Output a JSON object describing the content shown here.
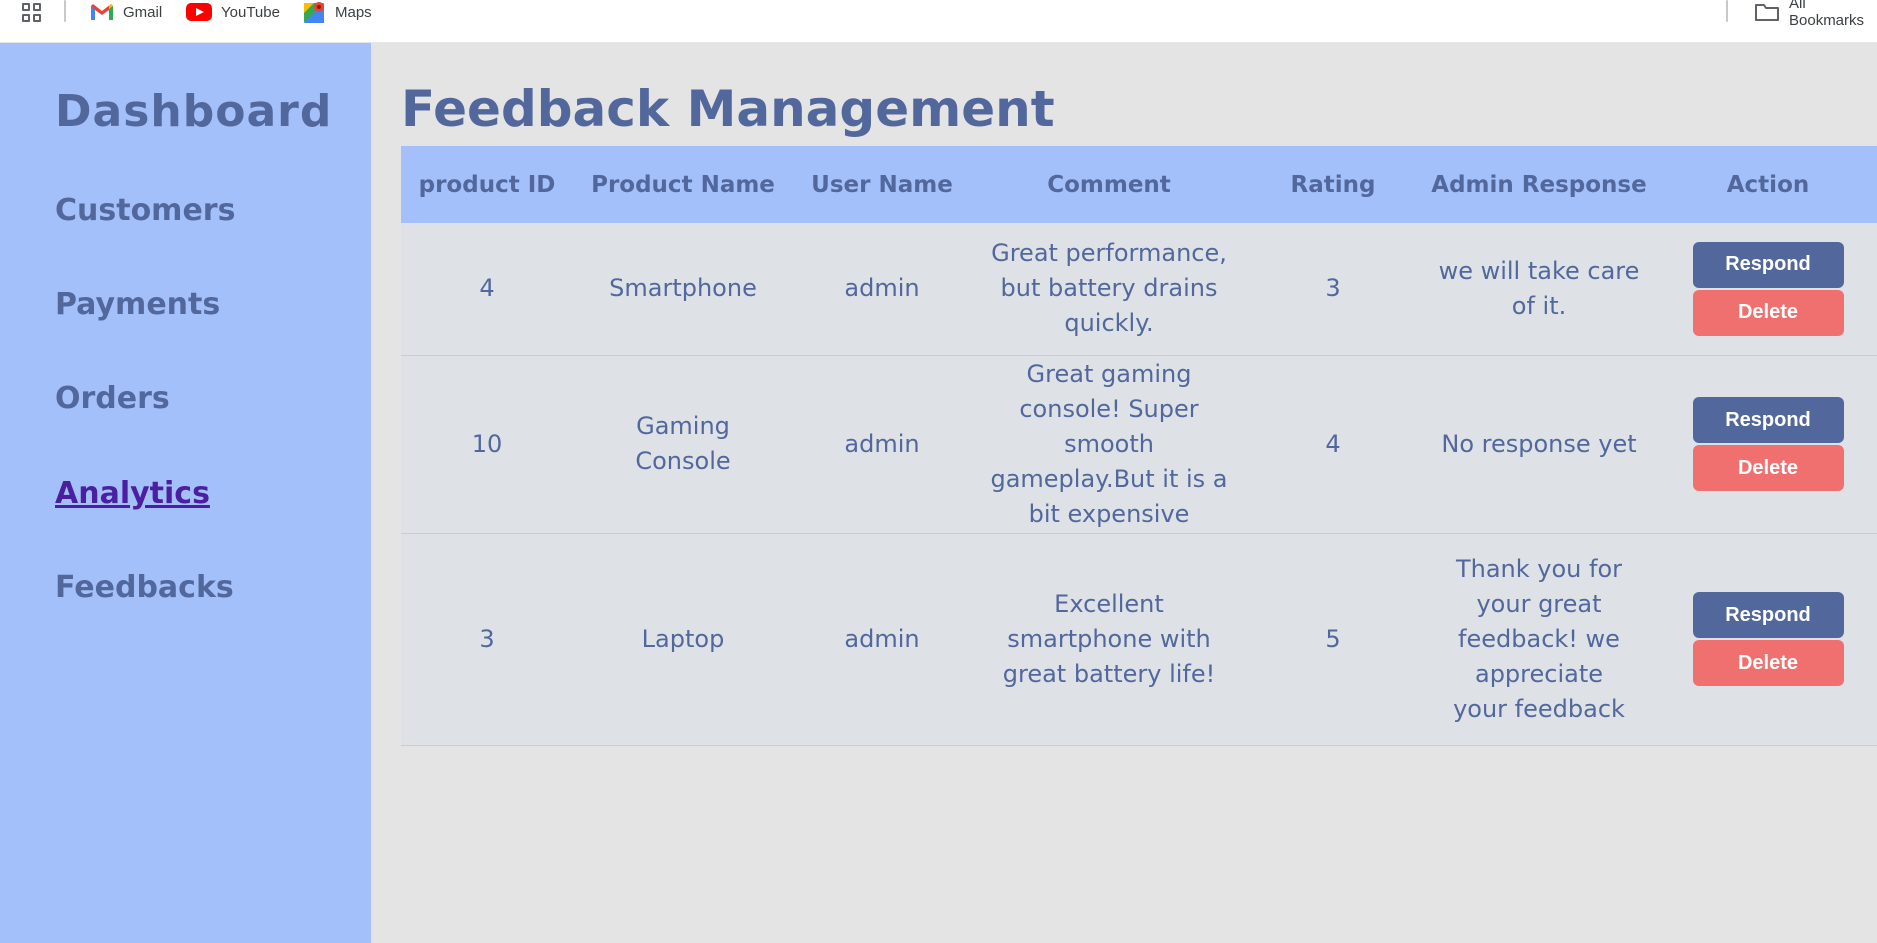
{
  "bookmarks": {
    "items": [
      {
        "label": "Gmail",
        "icon": "gmail-icon"
      },
      {
        "label": "YouTube",
        "icon": "youtube-icon"
      },
      {
        "label": "Maps",
        "icon": "maps-icon"
      }
    ],
    "all_bookmarks": "All Bookmarks"
  },
  "sidebar": {
    "title": "Dashboard",
    "items": [
      {
        "label": "Customers"
      },
      {
        "label": "Payments"
      },
      {
        "label": "Orders"
      },
      {
        "label": "Analytics"
      },
      {
        "label": "Feedbacks"
      }
    ]
  },
  "main": {
    "title": "Feedback Management",
    "columns": [
      "product ID",
      "Product Name",
      "User Name",
      "Comment",
      "Rating",
      "Admin Response",
      "Action"
    ],
    "rows": [
      {
        "product_id": "4",
        "product_name": "Smartphone",
        "user_name": "admin",
        "comment": "Great performance, but battery drains quickly.",
        "rating": "3",
        "admin_response": "we will take care of it."
      },
      {
        "product_id": "10",
        "product_name": "Gaming Console",
        "user_name": "admin",
        "comment": "Great gaming console! Super smooth gameplay.But it is a bit expensive",
        "rating": "4",
        "admin_response": "No response yet"
      },
      {
        "product_id": "3",
        "product_name": "Laptop",
        "user_name": "admin",
        "comment": "Excellent smartphone with great battery life!",
        "rating": "5",
        "admin_response": "Thank you for your great feedback! we appreciate your feedback"
      }
    ],
    "respond_label": "Respond",
    "delete_label": "Delete"
  },
  "colors": {
    "sidebar_bg": "#a4c0fb",
    "text_primary": "#52689d",
    "visited_link": "#4a1fa0",
    "respond_btn": "#52689d",
    "delete_btn": "#f07070"
  }
}
